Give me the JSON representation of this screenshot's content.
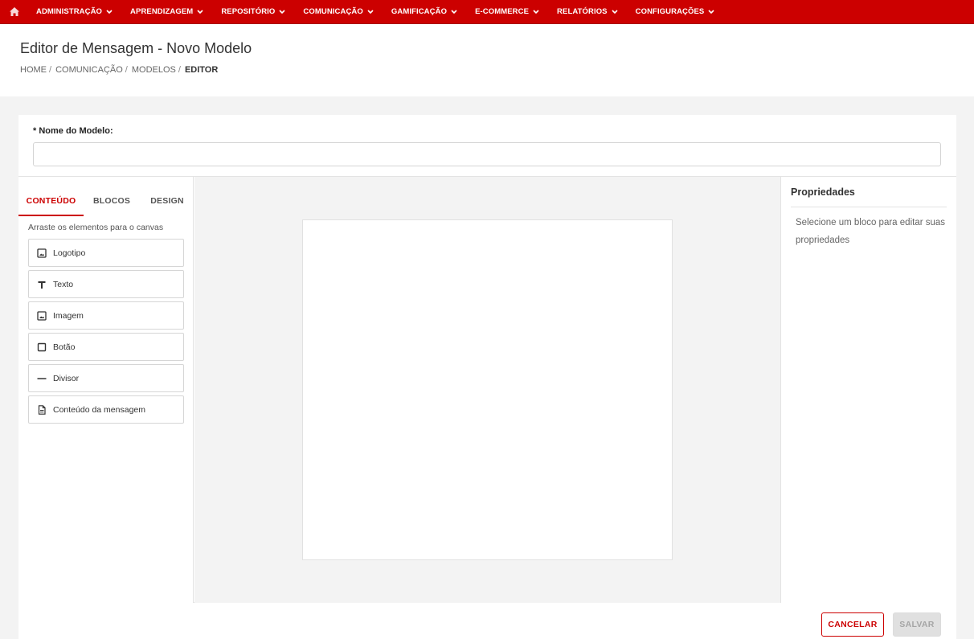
{
  "topnav": {
    "home_icon": "home-icon",
    "items": [
      {
        "label": "ADMINISTRAÇÃO"
      },
      {
        "label": "APRENDIZAGEM"
      },
      {
        "label": "REPOSITÓRIO"
      },
      {
        "label": "COMUNICAÇÃO"
      },
      {
        "label": "GAMIFICAÇÃO"
      },
      {
        "label": "E-COMMERCE"
      },
      {
        "label": "RELATÓRIOS"
      },
      {
        "label": "CONFIGURAÇÕES"
      }
    ],
    "background_color": "#cc0000"
  },
  "header": {
    "title": "Editor de Mensagem - Novo Modelo",
    "breadcrumb": [
      {
        "label": "HOME"
      },
      {
        "label": "COMUNICAÇÃO"
      },
      {
        "label": "MODELOS"
      },
      {
        "label": "EDITOR"
      }
    ],
    "breadcrumb_separator": "/"
  },
  "form": {
    "name_label": "* Nome do Modelo:",
    "name_value": "",
    "name_placeholder": ""
  },
  "left_panel": {
    "tabs": [
      {
        "label": "CONTEÚDO",
        "active": true
      },
      {
        "label": "BLOCOS",
        "active": false
      },
      {
        "label": "DESIGN",
        "active": false
      }
    ],
    "hint": "Arraste os elementos para o canvas",
    "elements": [
      {
        "label": "Logotipo",
        "icon": "image-icon"
      },
      {
        "label": "Texto",
        "icon": "text-icon"
      },
      {
        "label": "Imagem",
        "icon": "image-icon"
      },
      {
        "label": "Botão",
        "icon": "button-icon"
      },
      {
        "label": "Divisor",
        "icon": "divider-icon"
      },
      {
        "label": "Conteúdo da mensagem",
        "icon": "document-icon"
      }
    ]
  },
  "right_panel": {
    "title": "Propriedades",
    "hint": "Selecione um bloco para editar suas propriedades"
  },
  "footer": {
    "cancel_label": "CANCELAR",
    "save_label": "SALVAR",
    "save_disabled": true
  },
  "colors": {
    "accent": "#cc0000",
    "page_background": "#f3f3f3"
  }
}
